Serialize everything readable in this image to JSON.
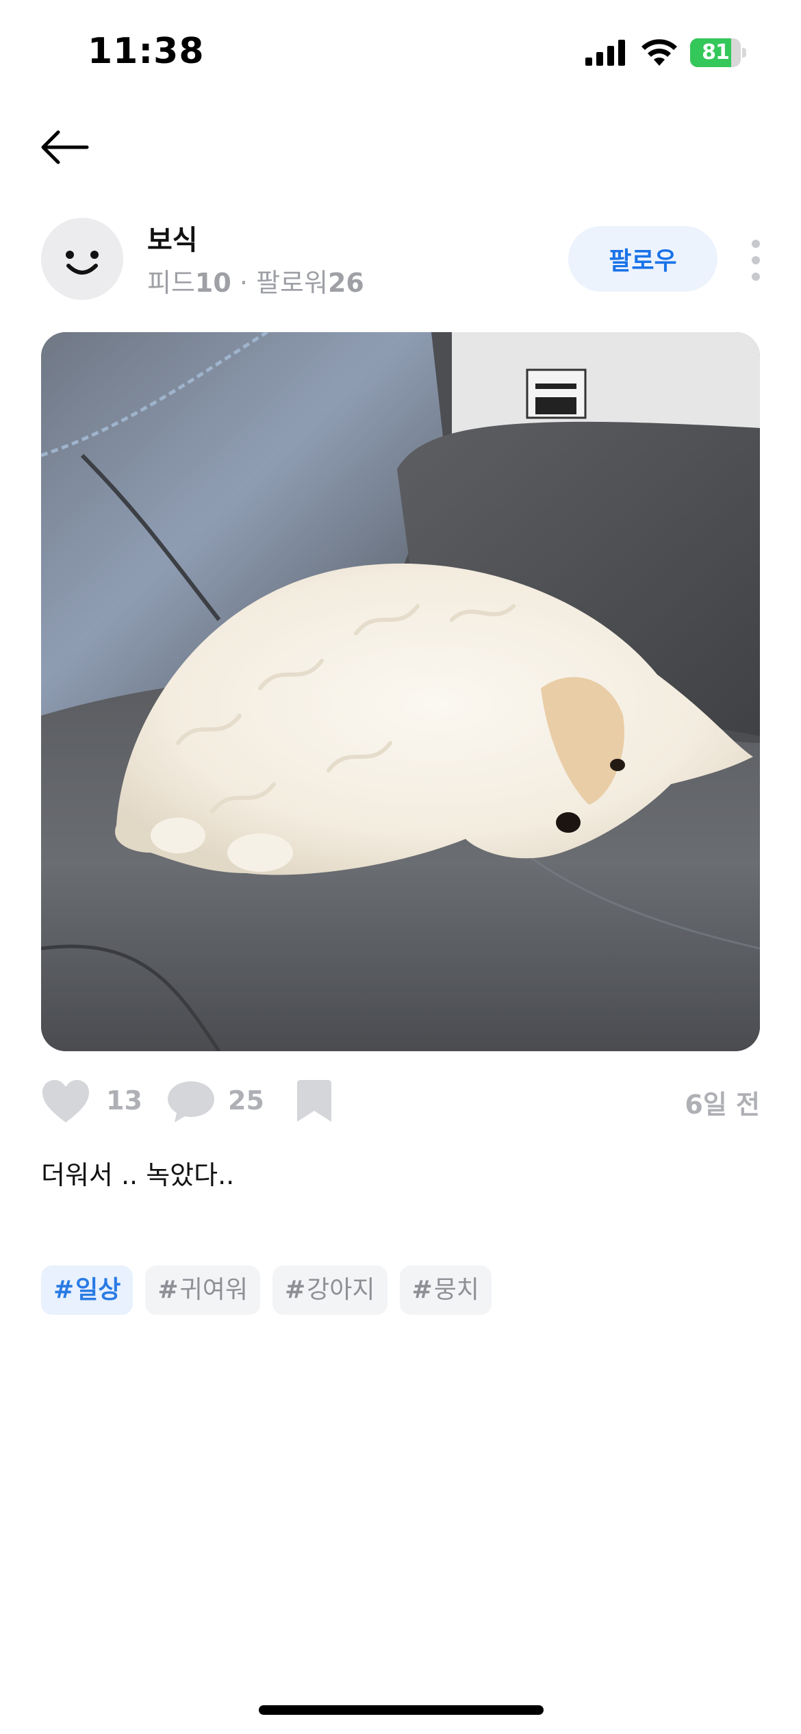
{
  "status_bar": {
    "time": "11:38",
    "battery_level": "81",
    "battery_fraction": 0.81,
    "charging": true
  },
  "nav": {
    "back_icon": "arrow-left-icon"
  },
  "profile": {
    "name": "보식",
    "feed_label": "피드",
    "feed_count": "10",
    "separator": "·",
    "follower_label": "팔로워",
    "follower_count": "26",
    "follow_label": "팔로우",
    "avatar_icon": "smiley-face-icon",
    "more_icon": "more-vertical-icon"
  },
  "post": {
    "photo_alt": "white fluffy dog lying on grey leather sofa",
    "like_count": "13",
    "comment_count": "25",
    "time_ago": "6일 전",
    "caption": "더워서 .. 녹았다..",
    "tags": [
      {
        "hash": "#",
        "label": "일상",
        "active": true
      },
      {
        "hash": "#",
        "label": "귀여워",
        "active": false
      },
      {
        "hash": "#",
        "label": "강아지",
        "active": false
      },
      {
        "hash": "#",
        "label": "뭉치",
        "active": false
      }
    ]
  },
  "colors": {
    "accent": "#1a73e8",
    "muted": "#aeb0b5",
    "tag_bg": "#f3f4f6",
    "battery_green": "#34c759"
  }
}
